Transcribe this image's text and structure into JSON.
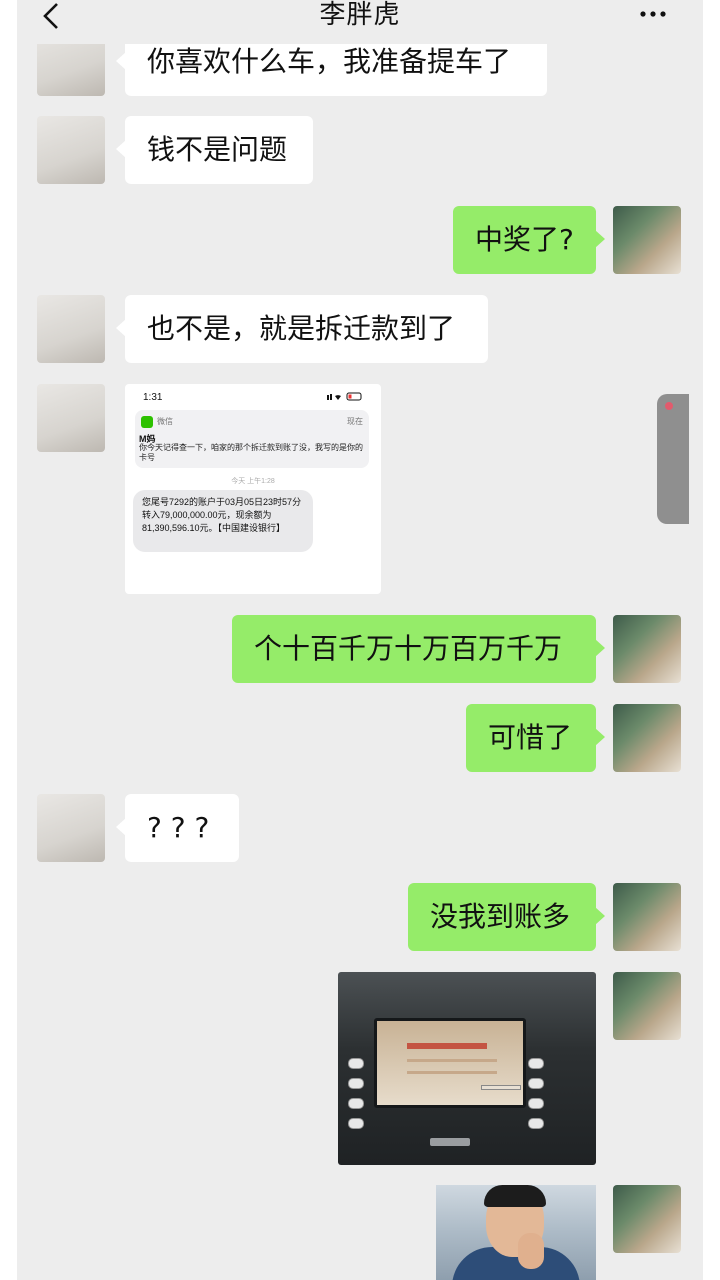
{
  "header": {
    "title": "李胖虎",
    "back_icon": "chevron-left-icon",
    "more_icon": "more-dots-icon"
  },
  "messages": [
    {
      "side": "left",
      "type": "text",
      "text": "你喜欢什么车，我准备提车了"
    },
    {
      "side": "left",
      "type": "text",
      "text": "钱不是问题"
    },
    {
      "side": "right",
      "type": "text",
      "text": "中奖了?"
    },
    {
      "side": "left",
      "type": "text",
      "text": "也不是，就是拆迁款到了"
    },
    {
      "side": "left",
      "type": "image",
      "image": "sms-screenshot"
    },
    {
      "side": "right",
      "type": "text",
      "text": "个十百千万十万百万千万"
    },
    {
      "side": "right",
      "type": "text",
      "text": "可惜了"
    },
    {
      "side": "left",
      "type": "text",
      "text": "? ? ?"
    },
    {
      "side": "right",
      "type": "text",
      "text": "没我到账多"
    },
    {
      "side": "right",
      "type": "image",
      "image": "atm-photo"
    },
    {
      "side": "right",
      "type": "image",
      "image": "person-photo"
    }
  ],
  "sms_image": {
    "status_time": "1:31",
    "app_name": "微信",
    "now_label": "现在",
    "sender": "M妈",
    "notification": "你今天记得查一下，咱家的那个拆迁款到账了没，我写的是你的卡号",
    "timestamp": "今天 上午1:28",
    "message": "您尾号7292的账户于03月05日23时57分转入79,000,000.00元，现余额为81,390,596.10元。【中国建设银行】"
  },
  "colors": {
    "chat_bg": "#ededed",
    "bubble_self": "#95ec69",
    "bubble_other": "#ffffff"
  }
}
